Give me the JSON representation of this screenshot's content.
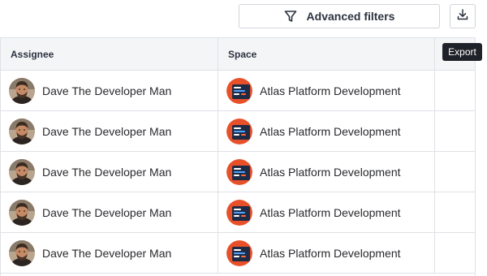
{
  "toolbar": {
    "advanced_filters_label": "Advanced filters",
    "filter_icon": "funnel-icon",
    "export_icon": "download-icon",
    "export_tooltip": "Export"
  },
  "table": {
    "columns": [
      "Assignee",
      "Space",
      ""
    ],
    "rows": [
      {
        "assignee": "Dave The Developer Man",
        "space": "Atlas Platform Development"
      },
      {
        "assignee": "Dave The Developer Man",
        "space": "Atlas Platform Development"
      },
      {
        "assignee": "Dave The Developer Man",
        "space": "Atlas Platform Development"
      },
      {
        "assignee": "Dave The Developer Man",
        "space": "Atlas Platform Development"
      },
      {
        "assignee": "Dave The Developer Man",
        "space": "Atlas Platform Development"
      }
    ]
  },
  "colors": {
    "space_icon_orange": "#e8502a",
    "space_icon_dark": "#1f2a44",
    "tooltip_bg": "#1f2329"
  }
}
